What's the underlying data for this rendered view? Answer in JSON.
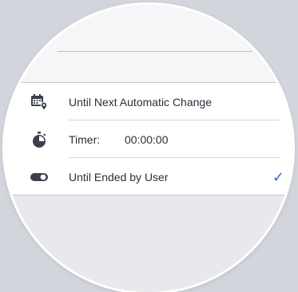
{
  "options": [
    {
      "label": "Until Next Automatic Change",
      "icon": "calendar-location-icon"
    },
    {
      "label": "Timer:",
      "value": "00:00:00",
      "icon": "stopwatch-icon"
    },
    {
      "label": "Until Ended by User",
      "icon": "toggle-icon",
      "selected": true
    }
  ],
  "selection_indicator": "✓",
  "colors": {
    "icon": "#3a3f4b",
    "check": "#2f6bd6",
    "list_background": "#ffffff",
    "lens_background": "#e9e9ed"
  }
}
